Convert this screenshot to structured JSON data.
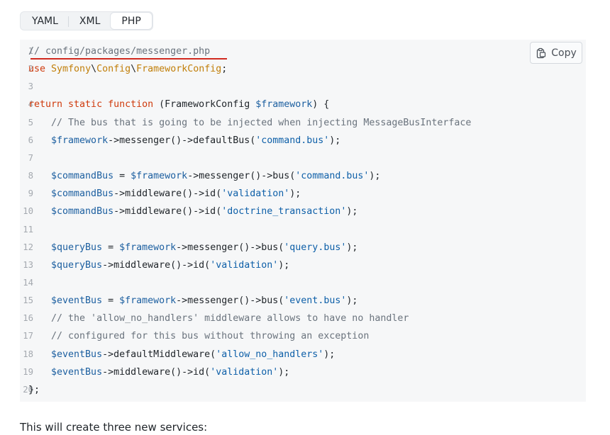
{
  "tabs": [
    {
      "label": "YAML",
      "active": false
    },
    {
      "label": "XML",
      "active": false
    },
    {
      "label": "PHP",
      "active": true
    }
  ],
  "copy_button": {
    "label": "Copy",
    "icon": "clipboard-icon"
  },
  "code_lines": [
    {
      "n": "1",
      "parts": [
        [
          "cm",
          "// config/packages/messenger.php"
        ]
      ]
    },
    {
      "n": "2",
      "parts": [
        [
          "kw",
          "use "
        ],
        [
          "ns",
          "Symfony"
        ],
        [
          "",
          "\\"
        ],
        [
          "ns",
          "Config"
        ],
        [
          "",
          "\\"
        ],
        [
          "ns",
          "FrameworkConfig"
        ],
        [
          "",
          ";"
        ]
      ]
    },
    {
      "n": "3",
      "parts": []
    },
    {
      "n": "4",
      "parts": [
        [
          "kw",
          "return static function "
        ],
        [
          "",
          "(FrameworkConfig "
        ],
        [
          "var",
          "$framework"
        ],
        [
          "",
          ") {"
        ]
      ]
    },
    {
      "n": "5",
      "parts": [
        [
          "cm",
          "    // The bus that is going to be injected when injecting MessageBusInterface"
        ]
      ]
    },
    {
      "n": "6",
      "parts": [
        [
          "var",
          "    $framework"
        ],
        [
          "",
          "->messenger()->defaultBus("
        ],
        [
          "str",
          "'command.bus'"
        ],
        [
          "",
          ");"
        ]
      ]
    },
    {
      "n": "7",
      "parts": []
    },
    {
      "n": "8",
      "parts": [
        [
          "var",
          "    $commandBus"
        ],
        [
          "",
          " = "
        ],
        [
          "var",
          "$framework"
        ],
        [
          "",
          "->messenger()->bus("
        ],
        [
          "str",
          "'command.bus'"
        ],
        [
          "",
          ");"
        ]
      ]
    },
    {
      "n": "9",
      "parts": [
        [
          "var",
          "    $commandBus"
        ],
        [
          "",
          "->middleware()->id("
        ],
        [
          "str",
          "'validation'"
        ],
        [
          "",
          ");"
        ]
      ]
    },
    {
      "n": "10",
      "parts": [
        [
          "var",
          "    $commandBus"
        ],
        [
          "",
          "->middleware()->id("
        ],
        [
          "str",
          "'doctrine_transaction'"
        ],
        [
          "",
          ");"
        ]
      ]
    },
    {
      "n": "11",
      "parts": []
    },
    {
      "n": "12",
      "parts": [
        [
          "var",
          "    $queryBus"
        ],
        [
          "",
          " = "
        ],
        [
          "var",
          "$framework"
        ],
        [
          "",
          "->messenger()->bus("
        ],
        [
          "str",
          "'query.bus'"
        ],
        [
          "",
          ");"
        ]
      ]
    },
    {
      "n": "13",
      "parts": [
        [
          "var",
          "    $queryBus"
        ],
        [
          "",
          "->middleware()->id("
        ],
        [
          "str",
          "'validation'"
        ],
        [
          "",
          ");"
        ]
      ]
    },
    {
      "n": "14",
      "parts": []
    },
    {
      "n": "15",
      "parts": [
        [
          "var",
          "    $eventBus"
        ],
        [
          "",
          " = "
        ],
        [
          "var",
          "$framework"
        ],
        [
          "",
          "->messenger()->bus("
        ],
        [
          "str",
          "'event.bus'"
        ],
        [
          "",
          ");"
        ]
      ]
    },
    {
      "n": "16",
      "parts": [
        [
          "cm",
          "    // the 'allow_no_handlers' middleware allows to have no handler"
        ]
      ]
    },
    {
      "n": "17",
      "parts": [
        [
          "cm",
          "    // configured for this bus without throwing an exception"
        ]
      ]
    },
    {
      "n": "18",
      "parts": [
        [
          "var",
          "    $eventBus"
        ],
        [
          "",
          "->defaultMiddleware("
        ],
        [
          "str",
          "'allow_no_handlers'"
        ],
        [
          "",
          ");"
        ]
      ]
    },
    {
      "n": "19",
      "parts": [
        [
          "var",
          "    $eventBus"
        ],
        [
          "",
          "->middleware()->id("
        ],
        [
          "str",
          "'validation'"
        ],
        [
          "",
          ");"
        ]
      ]
    },
    {
      "n": "20",
      "parts": [
        [
          "",
          "};"
        ]
      ]
    }
  ],
  "footer_text": "This will create three new services:",
  "colors": {
    "keyword": "#cf3a0c",
    "namespace": "#c17f09",
    "variable": "#1c5fa0",
    "string": "#0d5fa8",
    "comment": "#6a737d",
    "underline": "#d12a1f"
  }
}
